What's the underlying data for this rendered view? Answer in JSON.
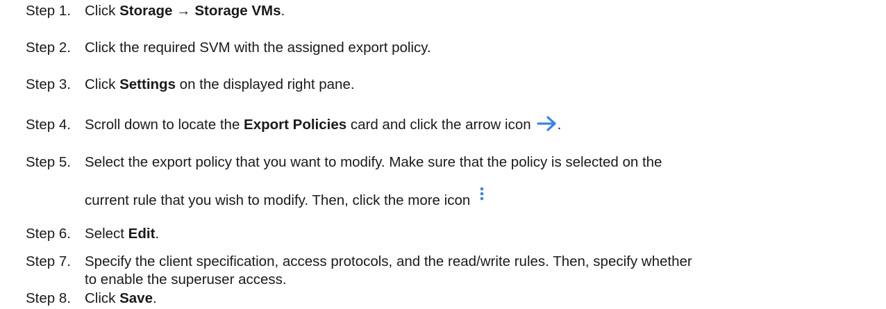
{
  "steps": [
    {
      "num": "Step 1.",
      "parts": [
        "Click ",
        "Storage → Storage VMs",
        "."
      ]
    },
    {
      "num": "Step 2.",
      "text": "Click the required SVM with the assigned export policy."
    },
    {
      "num": "Step 3.",
      "parts": [
        "Click ",
        "Settings",
        " on the displayed right pane."
      ]
    },
    {
      "num": "Step 4.",
      "parts": [
        "Scroll down to locate the ",
        "Export Policies",
        " card and click the arrow icon",
        "."
      ],
      "icon": "arrow-right-icon",
      "icon_color": "#3b82e6"
    },
    {
      "num": "Step 5.",
      "line1": "Select the export policy that you want to modify. Make sure that the policy is selected on the",
      "line2": "current rule that you wish to modify. Then, click the more icon",
      "icon": "more-vertical-icon",
      "icon_color": "#3b82e6"
    },
    {
      "num": "Step 6.",
      "parts": [
        "Select ",
        "Edit",
        "."
      ]
    },
    {
      "num": "Step 7.",
      "line1": "Specify the client specification, access protocols, and the read/write rules. Then, specify whether",
      "line2": "to enable the superuser access."
    },
    {
      "num": "Step 8.",
      "parts": [
        "Click ",
        "Save",
        "."
      ]
    }
  ]
}
